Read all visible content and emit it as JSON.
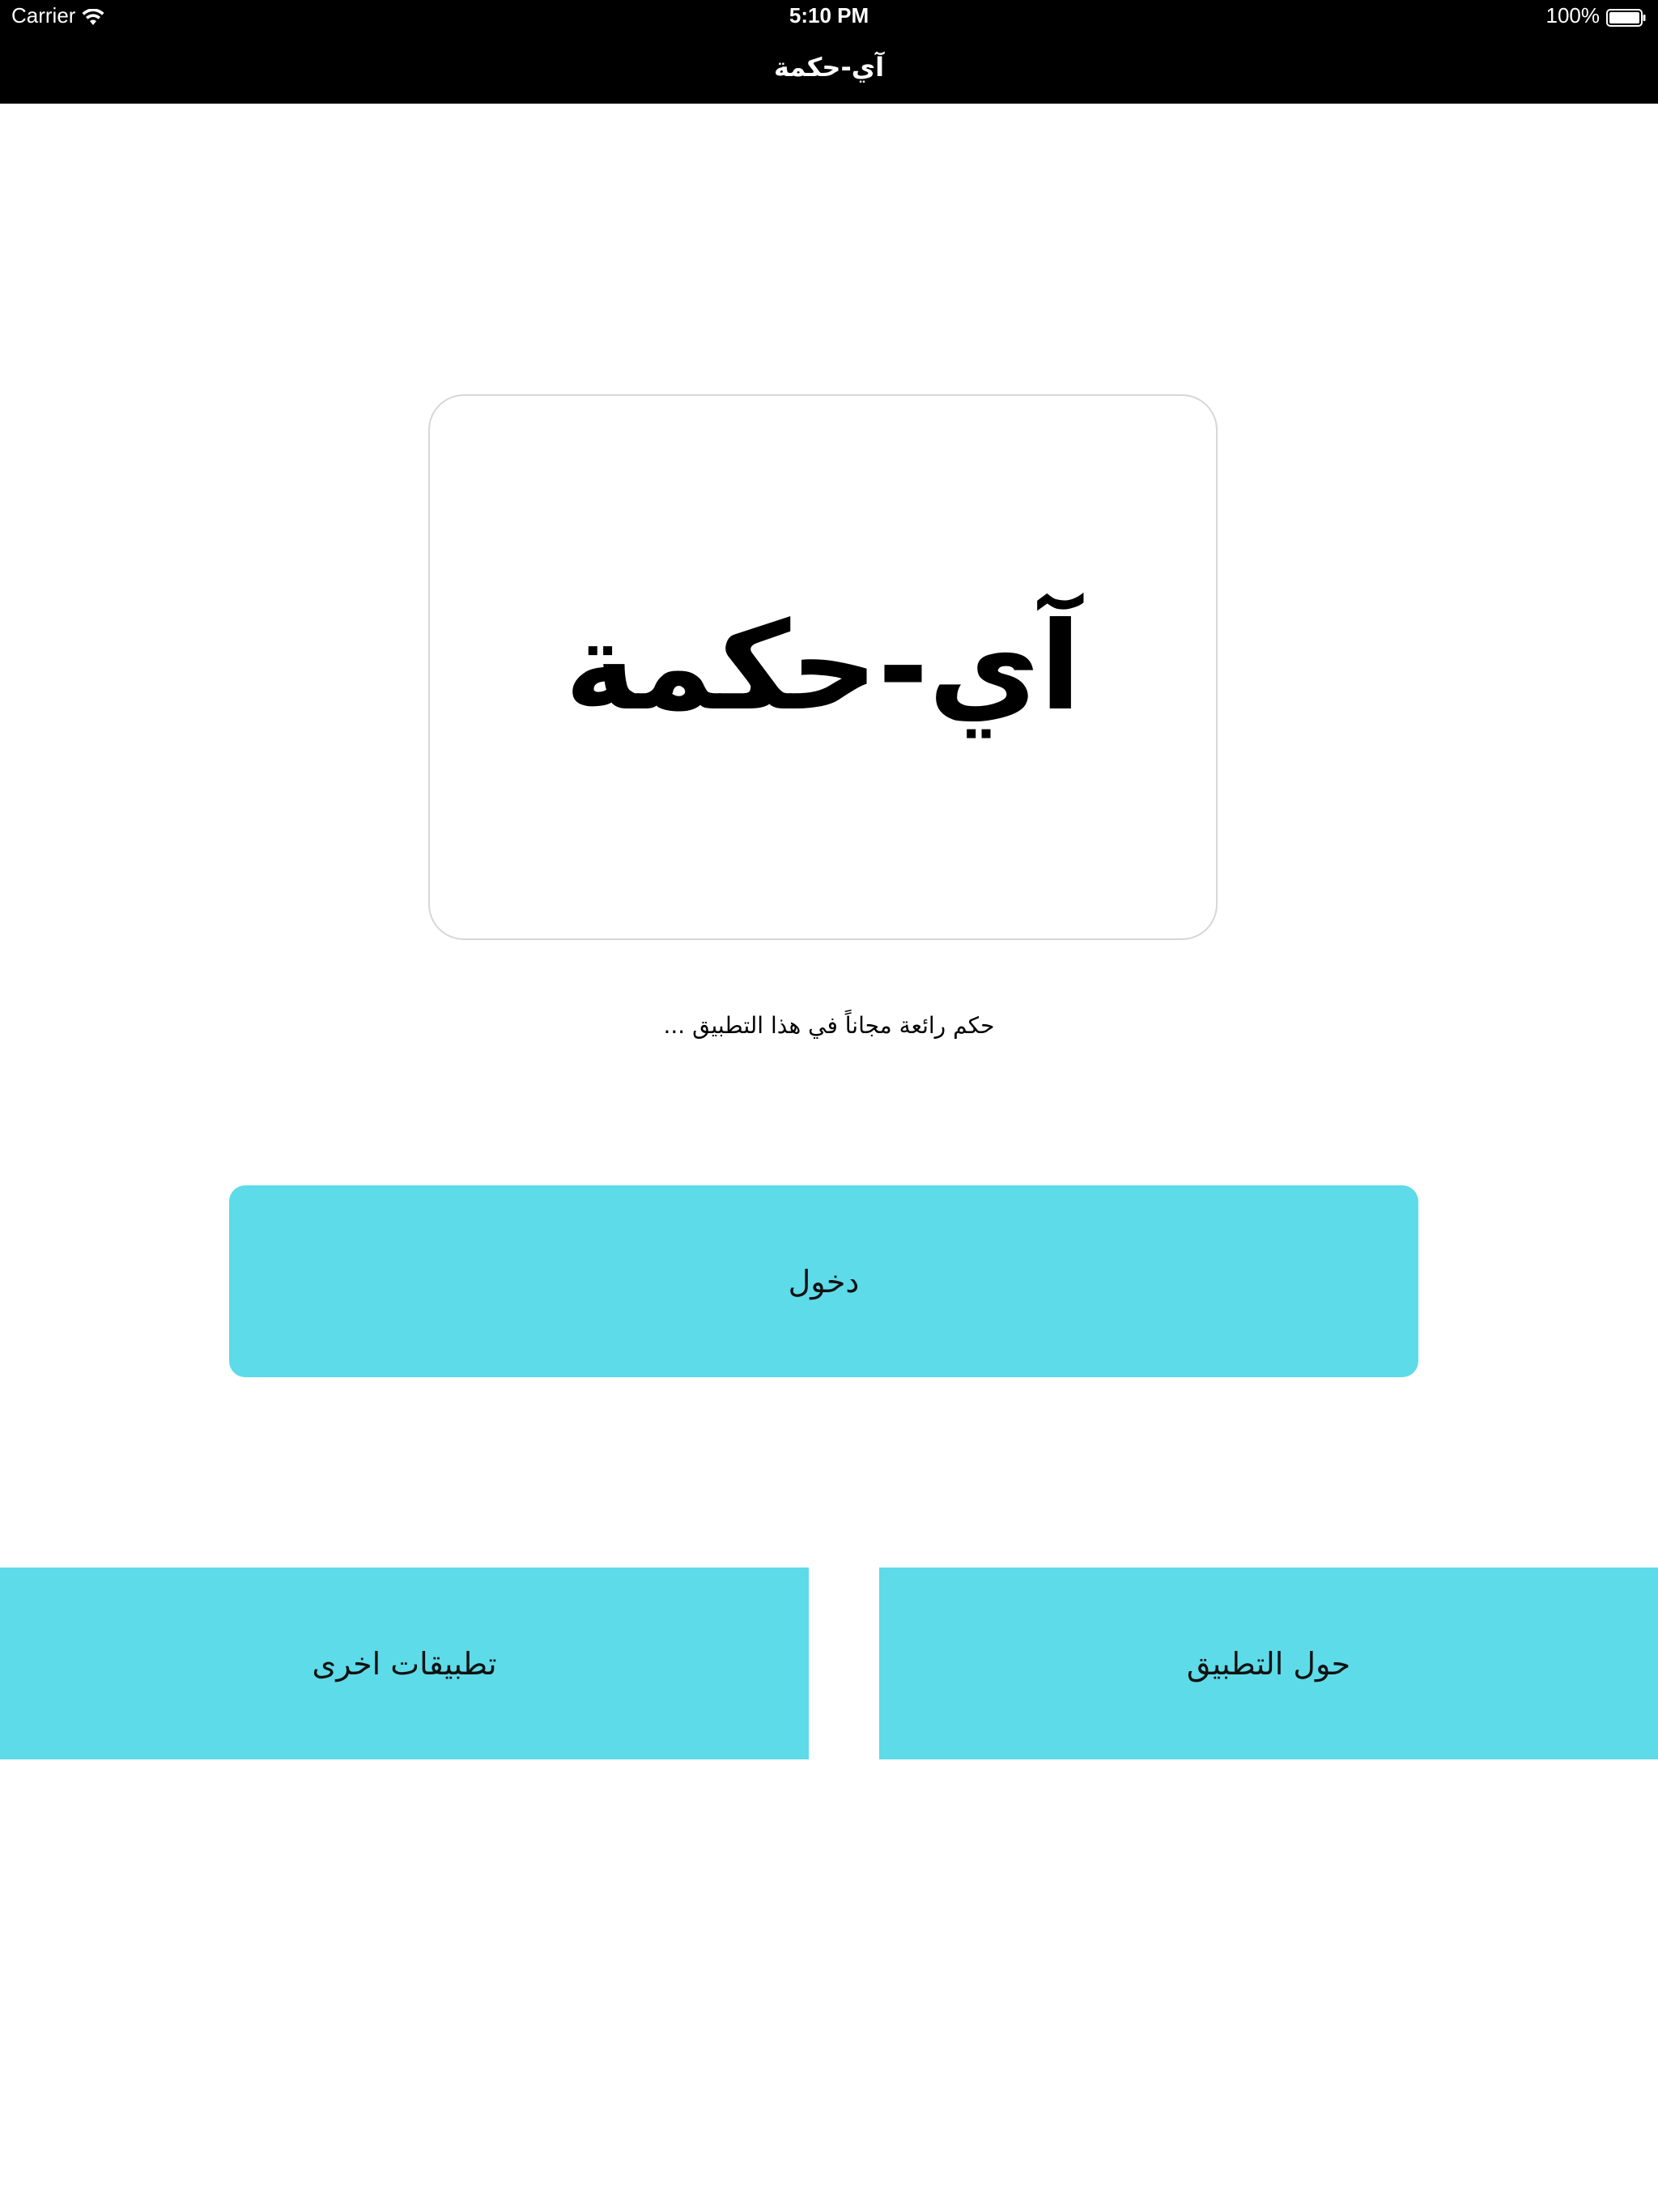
{
  "status_bar": {
    "carrier": "Carrier",
    "time": "5:10 PM",
    "battery": "100%"
  },
  "nav": {
    "title": "آي-حكمة"
  },
  "logo": {
    "text": "آي-حكمة"
  },
  "tagline": "حكم رائعة مجاناً في هذا التطبيق ...",
  "buttons": {
    "enter": "دخول",
    "other_apps": "تطبيقات اخرى",
    "about": "حول التطبيق"
  },
  "colors": {
    "topbar": "#000000",
    "button_bg": "#5ddbe8",
    "card_border": "#d7d7d7"
  }
}
